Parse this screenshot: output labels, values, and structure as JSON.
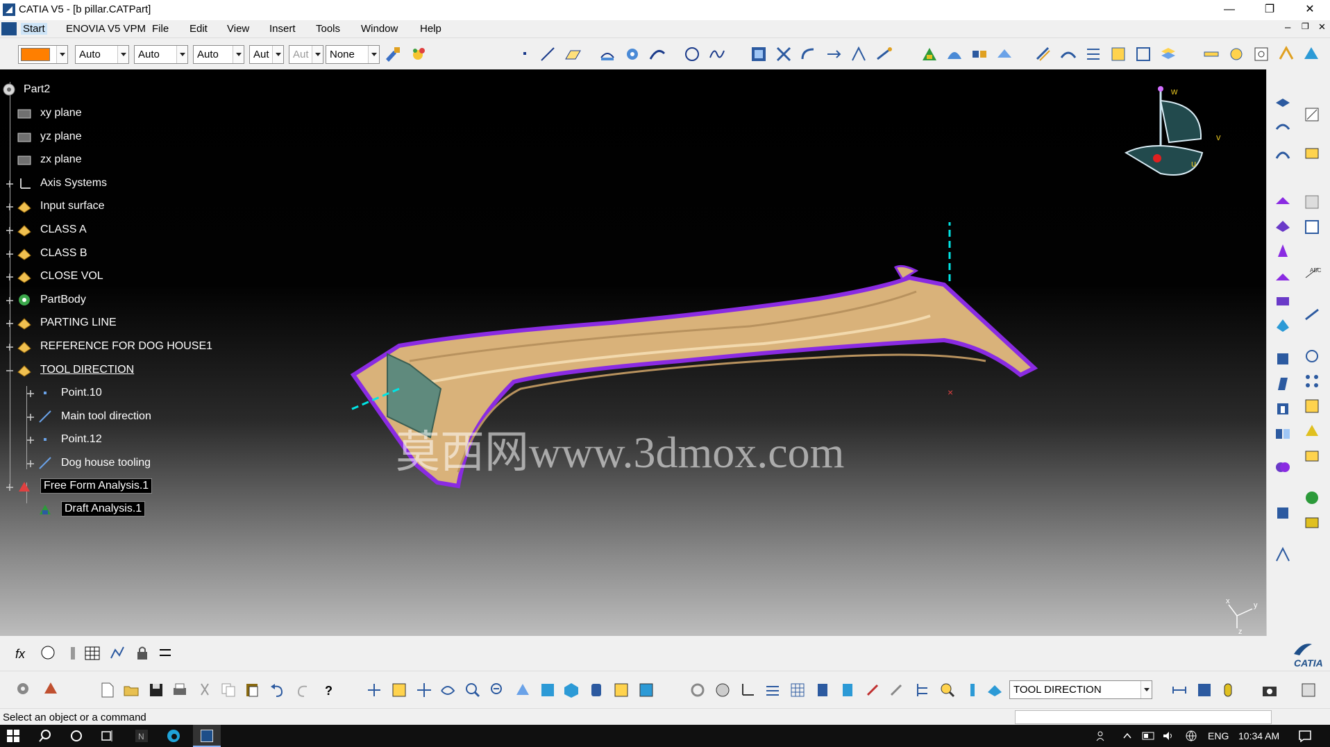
{
  "window": {
    "title": "CATIA V5 - [b pillar.CATPart]",
    "controls": {
      "minimize": "—",
      "restore": "❐",
      "close": "✕"
    }
  },
  "menubar": {
    "items": [
      "Start",
      "ENOVIA V5 VPM",
      "File",
      "Edit",
      "View",
      "Insert",
      "Tools",
      "Window",
      "Help"
    ],
    "doc_controls": {
      "minimize": "–",
      "restore": "❐",
      "close": "✕"
    }
  },
  "graphic_properties": {
    "color": "#ff7f00",
    "linetype": "Auto",
    "thickness": "Auto",
    "transparency": "Auto",
    "layer_short": "Aut",
    "disabled_field": "Aut",
    "filter": "None"
  },
  "tree": {
    "root": "Part2",
    "nodes": [
      {
        "label": "xy plane",
        "icon": "plane-icon",
        "expandable": false
      },
      {
        "label": "yz plane",
        "icon": "plane-icon",
        "expandable": false
      },
      {
        "label": "zx plane",
        "icon": "plane-icon",
        "expandable": false
      },
      {
        "label": "Axis Systems",
        "icon": "axis-system-icon",
        "expandable": true
      },
      {
        "label": "Input surface",
        "icon": "geometrical-set-icon",
        "expandable": true
      },
      {
        "label": "CLASS A",
        "icon": "geometrical-set-icon",
        "expandable": true
      },
      {
        "label": "CLASS B",
        "icon": "geometrical-set-icon",
        "expandable": true
      },
      {
        "label": "CLOSE VOL",
        "icon": "geometrical-set-icon",
        "expandable": true
      },
      {
        "label": "PartBody",
        "icon": "partbody-icon",
        "expandable": true
      },
      {
        "label": "PARTING LINE",
        "icon": "geometrical-set-icon",
        "expandable": true
      },
      {
        "label": "REFERENCE FOR DOG HOUSE1",
        "icon": "geometrical-set-icon",
        "expandable": true
      },
      {
        "label": "TOOL DIRECTION",
        "icon": "geometrical-set-icon",
        "expandable": true,
        "active": true
      },
      {
        "label": "Point.10",
        "icon": "point-icon",
        "expandable": true,
        "child": true
      },
      {
        "label": "Main tool direction",
        "icon": "line-icon",
        "expandable": true,
        "child": true
      },
      {
        "label": "Point.12",
        "icon": "point-icon",
        "expandable": true,
        "child": true
      },
      {
        "label": "Dog house tooling",
        "icon": "line-icon",
        "expandable": true,
        "child": true
      },
      {
        "label": "Free Form Analysis.1",
        "icon": "analysis-set-icon",
        "expandable": true,
        "boxed": true
      },
      {
        "label": "Draft Analysis.1",
        "icon": "draft-analysis-icon",
        "expandable": false,
        "child": true,
        "boxed": true
      }
    ]
  },
  "viewport": {
    "watermark": "莫西网www.3dmox.com",
    "compass_labels": {
      "w": "w",
      "v": "v",
      "u": "u"
    },
    "axis_labels": {
      "x": "x",
      "y": "y",
      "z": "z"
    },
    "model_colors": {
      "surface": "#d9b27a",
      "edge": "#8a2be2",
      "direction": "#00e5e5",
      "doghouse": "#5f8a7d"
    }
  },
  "bottom": {
    "current_set": "TOOL DIRECTION",
    "brand": "CATIA"
  },
  "status": {
    "message": "Select an object or a command"
  },
  "taskbar": {
    "language": "ENG",
    "time": "10:34 AM"
  }
}
